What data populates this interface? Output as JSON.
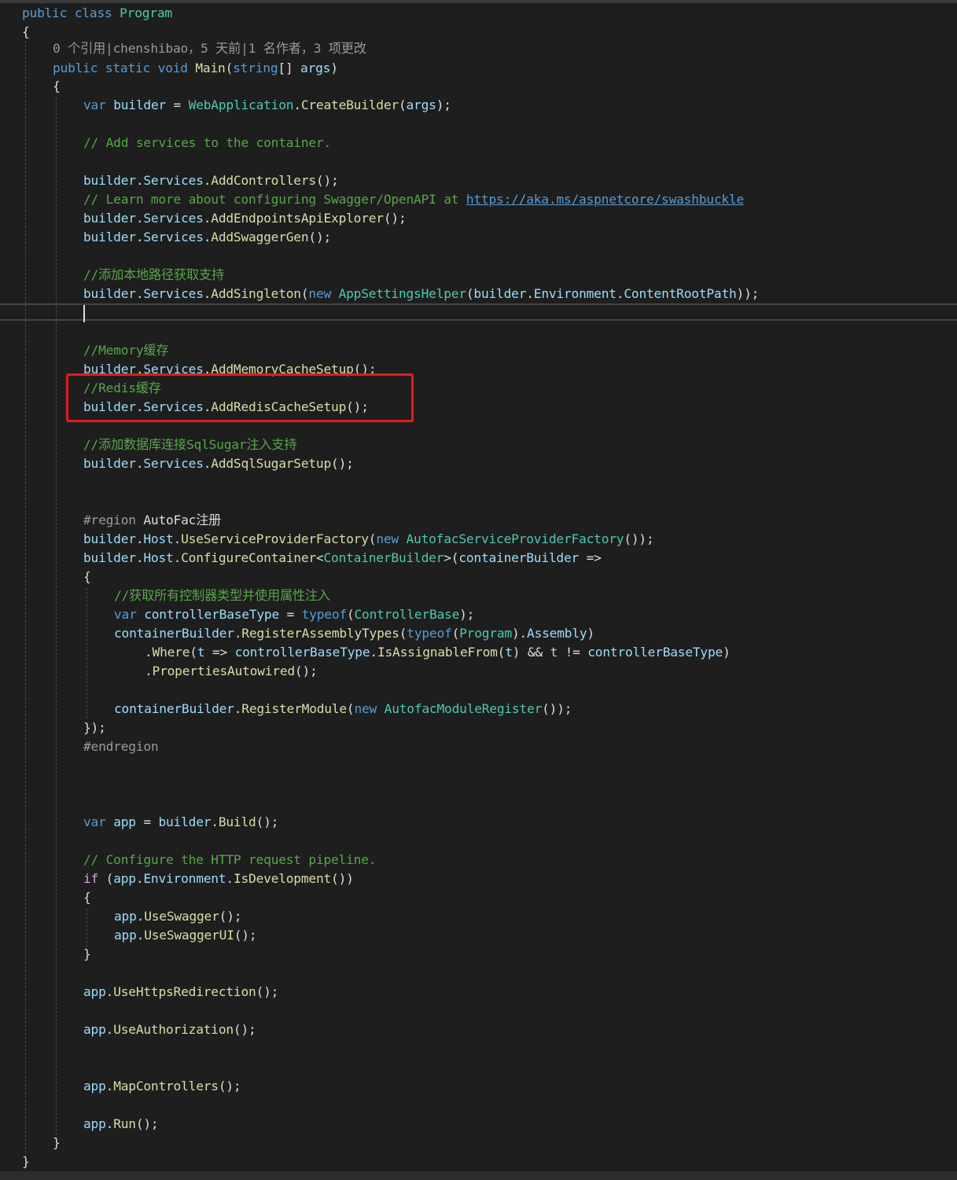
{
  "editor": {
    "lines": [
      [
        {
          "t": "public",
          "c": "kw"
        },
        {
          "t": " ",
          "c": "txt"
        },
        {
          "t": "class",
          "c": "kw"
        },
        {
          "t": " ",
          "c": "txt"
        },
        {
          "t": "Program",
          "c": "cls"
        }
      ],
      [
        {
          "t": "{",
          "c": "txt"
        }
      ],
      [
        {
          "t": "0 个引用|chenshibao，5 天前|1 名作者，3 项更改",
          "c": "lens"
        }
      ],
      [
        {
          "t": "public",
          "c": "kw"
        },
        {
          "t": " ",
          "c": "txt"
        },
        {
          "t": "static",
          "c": "kw"
        },
        {
          "t": " ",
          "c": "txt"
        },
        {
          "t": "void",
          "c": "kw"
        },
        {
          "t": " ",
          "c": "txt"
        },
        {
          "t": "Main",
          "c": "mth"
        },
        {
          "t": "(",
          "c": "txt"
        },
        {
          "t": "string",
          "c": "kw"
        },
        {
          "t": "[] ",
          "c": "txt"
        },
        {
          "t": "args",
          "c": "var"
        },
        {
          "t": ")",
          "c": "txt"
        }
      ],
      [
        {
          "t": "{",
          "c": "txt"
        }
      ],
      [
        {
          "t": "var",
          "c": "kw"
        },
        {
          "t": " ",
          "c": "txt"
        },
        {
          "t": "builder",
          "c": "var"
        },
        {
          "t": " = ",
          "c": "txt"
        },
        {
          "t": "WebApplication",
          "c": "cls"
        },
        {
          "t": ".",
          "c": "txt"
        },
        {
          "t": "CreateBuilder",
          "c": "mth"
        },
        {
          "t": "(",
          "c": "txt"
        },
        {
          "t": "args",
          "c": "var"
        },
        {
          "t": ");",
          "c": "txt"
        }
      ],
      [
        {
          "t": "// Add services to the container.",
          "c": "cmt"
        }
      ],
      [
        {
          "t": "builder",
          "c": "var"
        },
        {
          "t": ".",
          "c": "txt"
        },
        {
          "t": "Services",
          "c": "var"
        },
        {
          "t": ".",
          "c": "txt"
        },
        {
          "t": "AddControllers",
          "c": "mth"
        },
        {
          "t": "();",
          "c": "txt"
        }
      ],
      [
        {
          "t": "// Learn more about configuring Swagger/OpenAPI at ",
          "c": "cmt"
        },
        {
          "t": "https://aka.ms/aspnetcore/swashbuckle",
          "c": "lnk"
        }
      ],
      [
        {
          "t": "builder",
          "c": "var"
        },
        {
          "t": ".",
          "c": "txt"
        },
        {
          "t": "Services",
          "c": "var"
        },
        {
          "t": ".",
          "c": "txt"
        },
        {
          "t": "AddEndpointsApiExplorer",
          "c": "mth"
        },
        {
          "t": "();",
          "c": "txt"
        }
      ],
      [
        {
          "t": "builder",
          "c": "var"
        },
        {
          "t": ".",
          "c": "txt"
        },
        {
          "t": "Services",
          "c": "var"
        },
        {
          "t": ".",
          "c": "txt"
        },
        {
          "t": "AddSwaggerGen",
          "c": "mth"
        },
        {
          "t": "();",
          "c": "txt"
        }
      ],
      [
        {
          "t": "//添加本地路径获取支持",
          "c": "cmt"
        }
      ],
      [
        {
          "t": "builder",
          "c": "var"
        },
        {
          "t": ".",
          "c": "txt"
        },
        {
          "t": "Services",
          "c": "var"
        },
        {
          "t": ".",
          "c": "txt"
        },
        {
          "t": "AddSingleton",
          "c": "mth"
        },
        {
          "t": "(",
          "c": "txt"
        },
        {
          "t": "new",
          "c": "kw"
        },
        {
          "t": " ",
          "c": "txt"
        },
        {
          "t": "AppSettingsHelper",
          "c": "cls"
        },
        {
          "t": "(",
          "c": "txt"
        },
        {
          "t": "builder",
          "c": "var"
        },
        {
          "t": ".",
          "c": "txt"
        },
        {
          "t": "Environment",
          "c": "var"
        },
        {
          "t": ".",
          "c": "txt"
        },
        {
          "t": "ContentRootPath",
          "c": "var"
        },
        {
          "t": "));",
          "c": "txt"
        }
      ],
      [
        {
          "t": "//Memory缓存",
          "c": "cmt"
        }
      ],
      [
        {
          "t": "builder",
          "c": "var"
        },
        {
          "t": ".",
          "c": "txt"
        },
        {
          "t": "Services",
          "c": "var"
        },
        {
          "t": ".",
          "c": "txt"
        },
        {
          "t": "AddMemoryCacheSetup",
          "c": "mth"
        },
        {
          "t": "();",
          "c": "txt"
        }
      ],
      [
        {
          "t": "//Redis缓存",
          "c": "cmt"
        }
      ],
      [
        {
          "t": "builder",
          "c": "var"
        },
        {
          "t": ".",
          "c": "txt"
        },
        {
          "t": "Services",
          "c": "var"
        },
        {
          "t": ".",
          "c": "txt"
        },
        {
          "t": "AddRedisCacheSetup",
          "c": "mth"
        },
        {
          "t": "();",
          "c": "txt"
        }
      ],
      [
        {
          "t": "//添加数据库连接SqlSugar注入支持",
          "c": "cmt"
        }
      ],
      [
        {
          "t": "builder",
          "c": "var"
        },
        {
          "t": ".",
          "c": "txt"
        },
        {
          "t": "Services",
          "c": "var"
        },
        {
          "t": ".",
          "c": "txt"
        },
        {
          "t": "AddSqlSugarSetup",
          "c": "mth"
        },
        {
          "t": "();",
          "c": "txt"
        }
      ],
      [
        {
          "t": "#region",
          "c": "pre"
        },
        {
          "t": " AutoFac注册",
          "c": "txt"
        }
      ],
      [
        {
          "t": "builder",
          "c": "var"
        },
        {
          "t": ".",
          "c": "txt"
        },
        {
          "t": "Host",
          "c": "var"
        },
        {
          "t": ".",
          "c": "txt"
        },
        {
          "t": "UseServiceProviderFactory",
          "c": "mth"
        },
        {
          "t": "(",
          "c": "txt"
        },
        {
          "t": "new",
          "c": "kw"
        },
        {
          "t": " ",
          "c": "txt"
        },
        {
          "t": "AutofacServiceProviderFactory",
          "c": "cls"
        },
        {
          "t": "());",
          "c": "txt"
        }
      ],
      [
        {
          "t": "builder",
          "c": "var"
        },
        {
          "t": ".",
          "c": "txt"
        },
        {
          "t": "Host",
          "c": "var"
        },
        {
          "t": ".",
          "c": "txt"
        },
        {
          "t": "ConfigureContainer",
          "c": "mth"
        },
        {
          "t": "<",
          "c": "txt"
        },
        {
          "t": "ContainerBuilder",
          "c": "cls"
        },
        {
          "t": ">(",
          "c": "txt"
        },
        {
          "t": "containerBuilder",
          "c": "var"
        },
        {
          "t": " =>",
          "c": "txt"
        }
      ],
      [
        {
          "t": "{",
          "c": "txt"
        }
      ],
      [
        {
          "t": "//获取所有控制器类型并使用属性注入",
          "c": "cmt"
        }
      ],
      [
        {
          "t": "var",
          "c": "kw"
        },
        {
          "t": " ",
          "c": "txt"
        },
        {
          "t": "controllerBaseType",
          "c": "var"
        },
        {
          "t": " = ",
          "c": "txt"
        },
        {
          "t": "typeof",
          "c": "kw"
        },
        {
          "t": "(",
          "c": "txt"
        },
        {
          "t": "ControllerBase",
          "c": "cls"
        },
        {
          "t": ");",
          "c": "txt"
        }
      ],
      [
        {
          "t": "containerBuilder",
          "c": "var"
        },
        {
          "t": ".",
          "c": "txt"
        },
        {
          "t": "RegisterAssemblyTypes",
          "c": "mth"
        },
        {
          "t": "(",
          "c": "txt"
        },
        {
          "t": "typeof",
          "c": "kw"
        },
        {
          "t": "(",
          "c": "txt"
        },
        {
          "t": "Program",
          "c": "cls"
        },
        {
          "t": ").",
          "c": "txt"
        },
        {
          "t": "Assembly",
          "c": "var"
        },
        {
          "t": ")",
          "c": "txt"
        }
      ],
      [
        {
          "t": ".",
          "c": "txt"
        },
        {
          "t": "Where",
          "c": "mth"
        },
        {
          "t": "(",
          "c": "txt"
        },
        {
          "t": "t",
          "c": "var"
        },
        {
          "t": " => ",
          "c": "txt"
        },
        {
          "t": "controllerBaseType",
          "c": "var"
        },
        {
          "t": ".",
          "c": "txt"
        },
        {
          "t": "IsAssignableFrom",
          "c": "mth"
        },
        {
          "t": "(",
          "c": "txt"
        },
        {
          "t": "t",
          "c": "var"
        },
        {
          "t": ") && ",
          "c": "txt"
        },
        {
          "t": "t",
          "c": "var"
        },
        {
          "t": " != ",
          "c": "txt"
        },
        {
          "t": "controllerBaseType",
          "c": "var"
        },
        {
          "t": ")",
          "c": "txt"
        }
      ],
      [
        {
          "t": ".",
          "c": "txt"
        },
        {
          "t": "PropertiesAutowired",
          "c": "mth"
        },
        {
          "t": "();",
          "c": "txt"
        }
      ],
      [
        {
          "t": "containerBuilder",
          "c": "var"
        },
        {
          "t": ".",
          "c": "txt"
        },
        {
          "t": "RegisterModule",
          "c": "mth"
        },
        {
          "t": "(",
          "c": "txt"
        },
        {
          "t": "new",
          "c": "kw"
        },
        {
          "t": " ",
          "c": "txt"
        },
        {
          "t": "AutofacModuleRegister",
          "c": "cls"
        },
        {
          "t": "());",
          "c": "txt"
        }
      ],
      [
        {
          "t": "});",
          "c": "txt"
        }
      ],
      [
        {
          "t": "#endregion",
          "c": "pre"
        }
      ],
      [
        {
          "t": "var",
          "c": "kw"
        },
        {
          "t": " ",
          "c": "txt"
        },
        {
          "t": "app",
          "c": "var"
        },
        {
          "t": " = ",
          "c": "txt"
        },
        {
          "t": "builder",
          "c": "var"
        },
        {
          "t": ".",
          "c": "txt"
        },
        {
          "t": "Build",
          "c": "mth"
        },
        {
          "t": "();",
          "c": "txt"
        }
      ],
      [
        {
          "t": "// Configure the HTTP request pipeline.",
          "c": "cmt"
        }
      ],
      [
        {
          "t": "if",
          "c": "ctrl"
        },
        {
          "t": " (",
          "c": "txt"
        },
        {
          "t": "app",
          "c": "var"
        },
        {
          "t": ".",
          "c": "txt"
        },
        {
          "t": "Environment",
          "c": "var"
        },
        {
          "t": ".",
          "c": "txt"
        },
        {
          "t": "IsDevelopment",
          "c": "mth"
        },
        {
          "t": "())",
          "c": "txt"
        }
      ],
      [
        {
          "t": "{",
          "c": "txt"
        }
      ],
      [
        {
          "t": "app",
          "c": "var"
        },
        {
          "t": ".",
          "c": "txt"
        },
        {
          "t": "UseSwagger",
          "c": "mth"
        },
        {
          "t": "();",
          "c": "txt"
        }
      ],
      [
        {
          "t": "app",
          "c": "var"
        },
        {
          "t": ".",
          "c": "txt"
        },
        {
          "t": "UseSwaggerUI",
          "c": "mth"
        },
        {
          "t": "();",
          "c": "txt"
        }
      ],
      [
        {
          "t": "}",
          "c": "txt"
        }
      ],
      [
        {
          "t": "app",
          "c": "var"
        },
        {
          "t": ".",
          "c": "txt"
        },
        {
          "t": "UseHttpsRedirection",
          "c": "mth"
        },
        {
          "t": "();",
          "c": "txt"
        }
      ],
      [
        {
          "t": "app",
          "c": "var"
        },
        {
          "t": ".",
          "c": "txt"
        },
        {
          "t": "UseAuthorization",
          "c": "mth"
        },
        {
          "t": "();",
          "c": "txt"
        }
      ],
      [
        {
          "t": "app",
          "c": "var"
        },
        {
          "t": ".",
          "c": "txt"
        },
        {
          "t": "MapControllers",
          "c": "mth"
        },
        {
          "t": "();",
          "c": "txt"
        }
      ],
      [
        {
          "t": "app",
          "c": "var"
        },
        {
          "t": ".",
          "c": "txt"
        },
        {
          "t": "Run",
          "c": "mth"
        },
        {
          "t": "();",
          "c": "txt"
        }
      ],
      [
        {
          "t": "}",
          "c": "txt"
        }
      ],
      [
        {
          "t": "}",
          "c": "txt"
        }
      ]
    ]
  },
  "colors": {
    "background": "#1e1e1e",
    "keyword": "#569cd6",
    "control_keyword": "#d8a0df",
    "class_name": "#4ec9b0",
    "method_name": "#dcdcaa",
    "variable": "#9cdcfe",
    "plain_text": "#dcdcdc",
    "comment": "#57a64a",
    "link": "#569cd6",
    "preprocessor": "#9b9b9b",
    "highlight_box": "#e41b1b"
  }
}
